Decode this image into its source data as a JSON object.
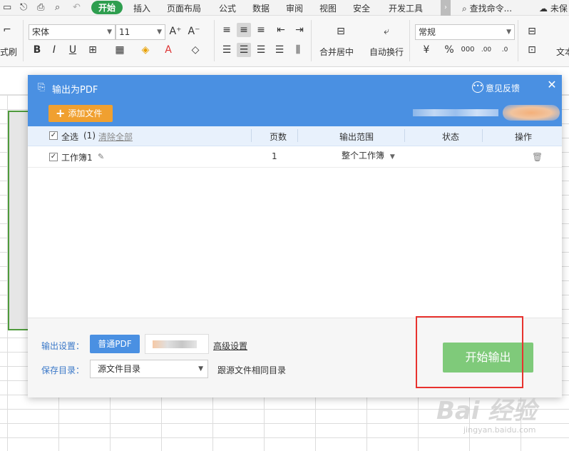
{
  "ribbon": {
    "tabs": [
      {
        "label": "开始",
        "active": true
      },
      {
        "label": "插入"
      },
      {
        "label": "页面布局"
      },
      {
        "label": "公式"
      },
      {
        "label": "数据"
      },
      {
        "label": "审阅"
      },
      {
        "label": "视图"
      },
      {
        "label": "安全"
      },
      {
        "label": "开发工具"
      }
    ],
    "search_command": "查找命令...",
    "sync_status": "未保"
  },
  "toolbar": {
    "format_painter_label": "式刷",
    "font_name": "宋体",
    "font_size": "11",
    "merge_center_label": "合并居中",
    "wrap_text_label": "自动换行",
    "number_format": "常规",
    "text_label": "文本"
  },
  "dialog": {
    "title": "输出为PDF",
    "feedback_label": "意见反馈",
    "add_file_label": "添加文件",
    "table": {
      "select_all_label": "全选",
      "select_count": "(1)",
      "clear_all_label": "清除全部",
      "columns": {
        "pages": "页数",
        "range": "输出范围",
        "status": "状态",
        "action": "操作"
      },
      "rows": [
        {
          "name": "工作簿1",
          "pages": "1",
          "range": "整个工作簿",
          "status": ""
        }
      ]
    },
    "footer": {
      "output_settings_label": "输出设置：",
      "normal_pdf_label": "普通PDF",
      "advanced_settings_label": "高级设置",
      "save_dir_label": "保存目录：",
      "save_dir_value": "源文件目录",
      "same_dir_label": "跟源文件相同目录",
      "start_button_label": "开始输出"
    }
  },
  "watermark": {
    "text": "Bai 经验",
    "sub": "jingyan.baidu.com"
  },
  "colors": {
    "header_blue": "#4a90e2",
    "add_file_orange": "#f0a030",
    "start_green": "#7fca7a",
    "highlight_red": "#e8322e",
    "active_tab_green": "#2e9e4f"
  }
}
